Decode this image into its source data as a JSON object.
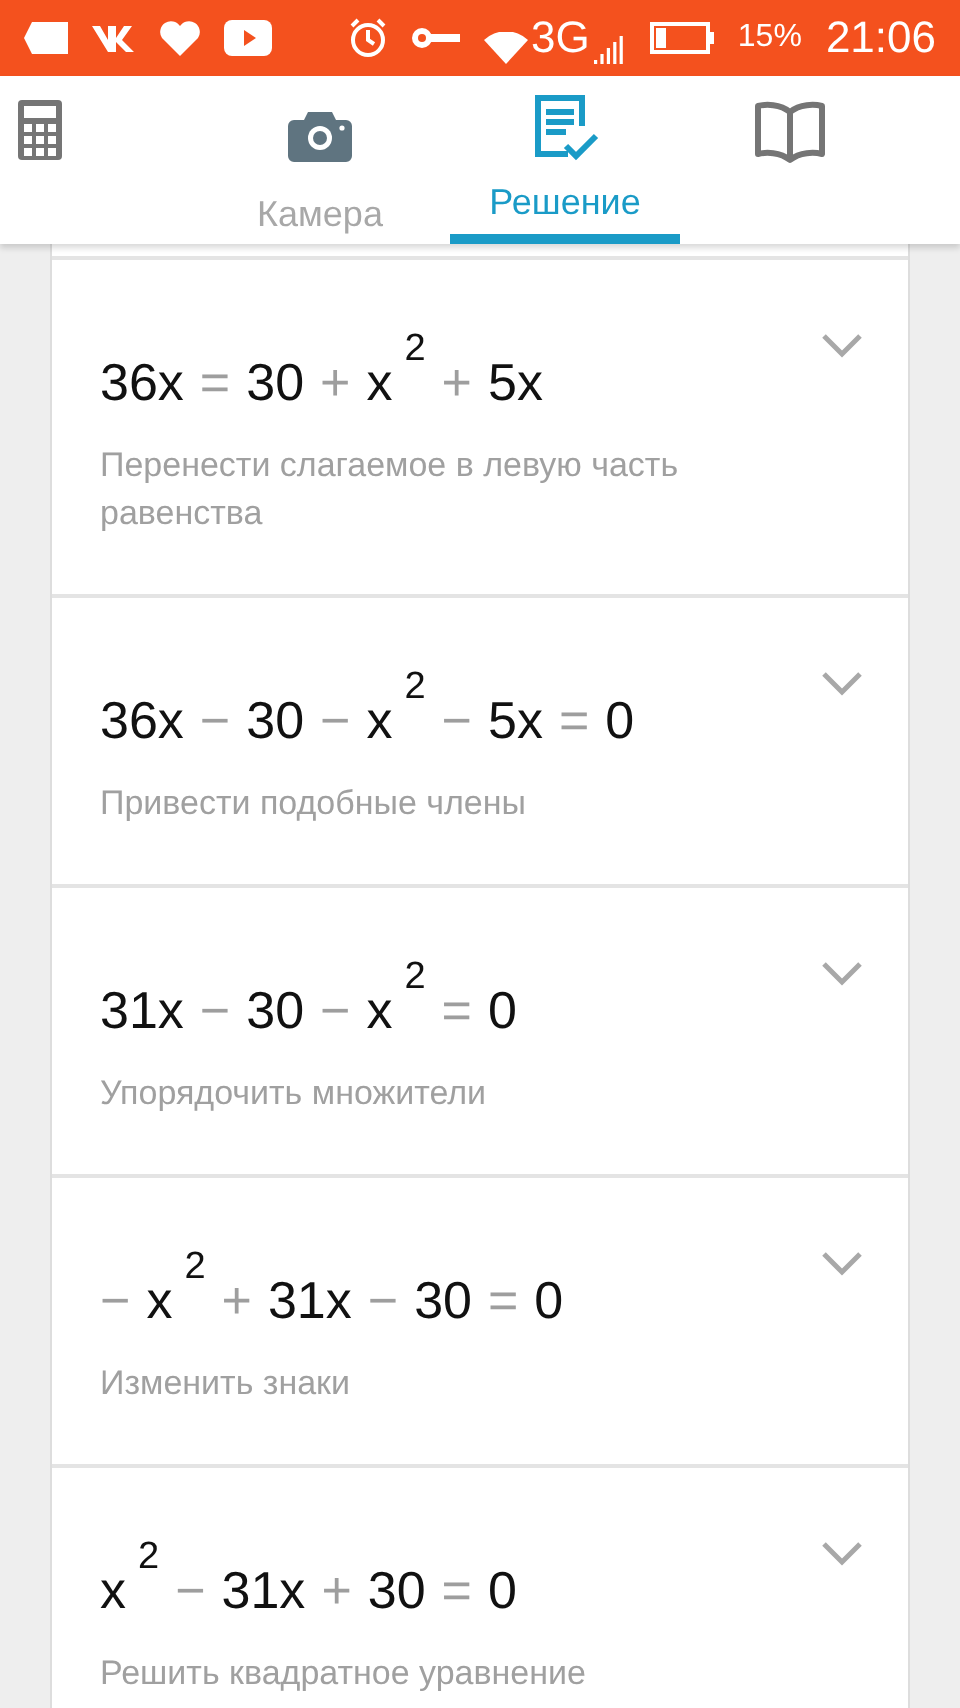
{
  "status_bar": {
    "network": "3G",
    "battery": "15%",
    "time": "21:06"
  },
  "tabs": [
    {
      "kind": "calculator",
      "selected": false
    },
    {
      "kind": "camera",
      "label": "Камера",
      "selected": false
    },
    {
      "kind": "solution",
      "label": "Решение",
      "selected": true
    },
    {
      "kind": "book",
      "selected": false
    }
  ],
  "steps": [
    {
      "equation": [
        {
          "kind": "term",
          "text": "36x"
        },
        {
          "kind": "op",
          "text": "="
        },
        {
          "kind": "term",
          "text": "30"
        },
        {
          "kind": "op",
          "text": "+"
        },
        {
          "kind": "term",
          "text": "x",
          "sup": "2"
        },
        {
          "kind": "op",
          "text": "+"
        },
        {
          "kind": "term",
          "text": "5x"
        }
      ],
      "description": "Перенести слагаемое в левую часть равенства",
      "expanded": false
    },
    {
      "equation": [
        {
          "kind": "term",
          "text": "36x"
        },
        {
          "kind": "op",
          "text": "−"
        },
        {
          "kind": "term",
          "text": "30"
        },
        {
          "kind": "op",
          "text": "−"
        },
        {
          "kind": "term",
          "text": "x",
          "sup": "2"
        },
        {
          "kind": "op",
          "text": "−"
        },
        {
          "kind": "term",
          "text": "5x"
        },
        {
          "kind": "op",
          "text": "="
        },
        {
          "kind": "term",
          "text": "0"
        }
      ],
      "description": "Привести подобные члены",
      "expanded": false
    },
    {
      "equation": [
        {
          "kind": "term",
          "text": "31x"
        },
        {
          "kind": "op",
          "text": "−"
        },
        {
          "kind": "term",
          "text": "30"
        },
        {
          "kind": "op",
          "text": "−"
        },
        {
          "kind": "term",
          "text": "x",
          "sup": "2"
        },
        {
          "kind": "op",
          "text": "="
        },
        {
          "kind": "term",
          "text": "0"
        }
      ],
      "description": "Упорядочить множители",
      "expanded": false
    },
    {
      "equation": [
        {
          "kind": "op",
          "text": "−"
        },
        {
          "kind": "term",
          "text": "x",
          "sup": "2"
        },
        {
          "kind": "op",
          "text": "+"
        },
        {
          "kind": "term",
          "text": "31x"
        },
        {
          "kind": "op",
          "text": "−"
        },
        {
          "kind": "term",
          "text": "30"
        },
        {
          "kind": "op",
          "text": "="
        },
        {
          "kind": "term",
          "text": "0"
        }
      ],
      "description": "Изменить знаки",
      "expanded": false
    },
    {
      "equation": [
        {
          "kind": "term",
          "text": "x",
          "sup": "2"
        },
        {
          "kind": "op",
          "text": "−"
        },
        {
          "kind": "term",
          "text": "31x"
        },
        {
          "kind": "op",
          "text": "+"
        },
        {
          "kind": "term",
          "text": "30"
        },
        {
          "kind": "op",
          "text": "="
        },
        {
          "kind": "term",
          "text": "0"
        }
      ],
      "description": "Решить квадратное уравнение",
      "expanded": false
    }
  ]
}
